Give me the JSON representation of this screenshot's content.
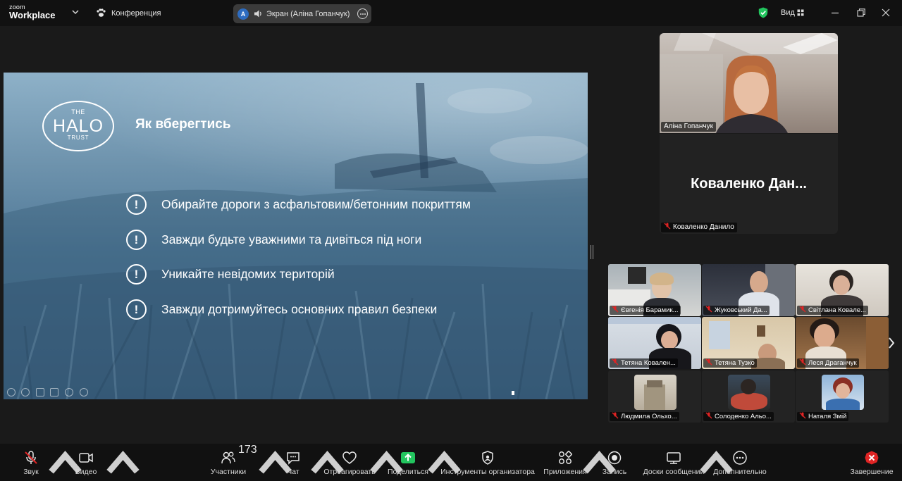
{
  "app": {
    "logo_small": "zoom",
    "logo_big": "Workplace",
    "meeting_title": "Конференция",
    "share_avatar_letter": "A",
    "share_label": "Экран (Аліна Гопанчук)",
    "view_label": "Вид"
  },
  "slide": {
    "logo_the": "THE",
    "logo_halo": "HALO",
    "logo_trust": "TRUST",
    "title": "Як вберегтись",
    "bullet_mark": "!",
    "bullets": [
      "Обирайте дороги з асфальтовим/бетонним покриттям",
      "Завжди будьте уважними та дивіться під ноги",
      "Уникайте невідомих територій",
      "Завжди дотримуйтесь основних правил безпеки"
    ]
  },
  "participants": {
    "main_video_name": "Аліна Гопанчук",
    "camera_off_display": "Коваленко  Дан...",
    "camera_off_name": "Коваленко Данило",
    "grid": [
      "Євгенія Барамик...",
      "Жуковський Да...",
      "Світлана Ковале...",
      "Тетяна  Ковален...",
      "Тетяна Тузко",
      "Леся Драганчук",
      "Людмила Ольхо...",
      "Солоденко Альо...",
      "Наталя Змій"
    ]
  },
  "toolbar": {
    "audio": "Звук",
    "video": "Видео",
    "participants": "Участники",
    "participants_count": "173",
    "chat": "Чат",
    "react": "Отреагировать",
    "share": "Поделиться",
    "host_tools": "Инструменты организатора",
    "apps": "Приложения",
    "record": "Запись",
    "whiteboards": "Доски сообщений",
    "more": "Дополнительно",
    "end": "Завершение"
  },
  "colors": {
    "accent_green": "#22c55e",
    "end_red": "#e02424",
    "avatar_blue": "#2d6cc0"
  }
}
